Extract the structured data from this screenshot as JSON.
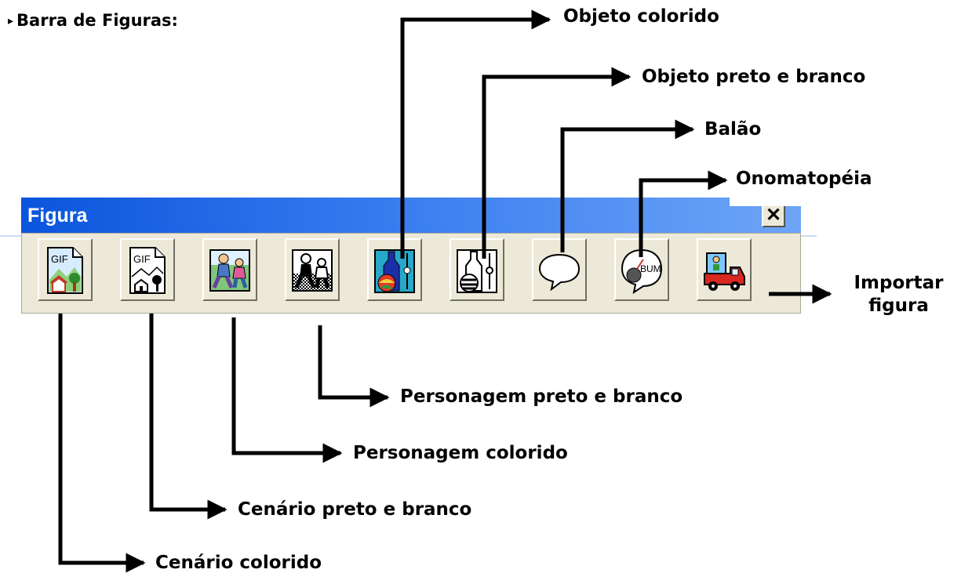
{
  "heading": {
    "bullet": "▸",
    "text": "Barra de Figuras:"
  },
  "window": {
    "title": "Figura",
    "close_glyph": "✕"
  },
  "buttons": [
    {
      "name": "cenario-colorido",
      "icon_text": "GIF"
    },
    {
      "name": "cenario-preto-e-branco",
      "icon_text": "GIF"
    },
    {
      "name": "personagem-colorido",
      "icon_text": ""
    },
    {
      "name": "personagem-preto-e-branco",
      "icon_text": ""
    },
    {
      "name": "objeto-colorido",
      "icon_text": ""
    },
    {
      "name": "objeto-preto-e-branco",
      "icon_text": ""
    },
    {
      "name": "balao",
      "icon_text": ""
    },
    {
      "name": "onomatopeia",
      "icon_text": "BUM"
    },
    {
      "name": "importar-figura",
      "icon_text": ""
    }
  ],
  "labels": {
    "objeto_colorido": "Objeto colorido",
    "objeto_preto_branco": "Objeto preto e branco",
    "balao": "Balão",
    "onomatopeia": "Onomatopéia",
    "importar_figura": "Importar figura",
    "personagem_preto_branco": "Personagem preto e branco",
    "personagem_colorido": "Personagem colorido",
    "cenario_preto_branco": "Cenário preto e branco",
    "cenario_colorido": "Cenário colorido"
  },
  "colors": {
    "titlebar_start": "#0a55dc",
    "titlebar_end": "#6ea5f7",
    "toolbar_bg": "#ece9d8"
  }
}
